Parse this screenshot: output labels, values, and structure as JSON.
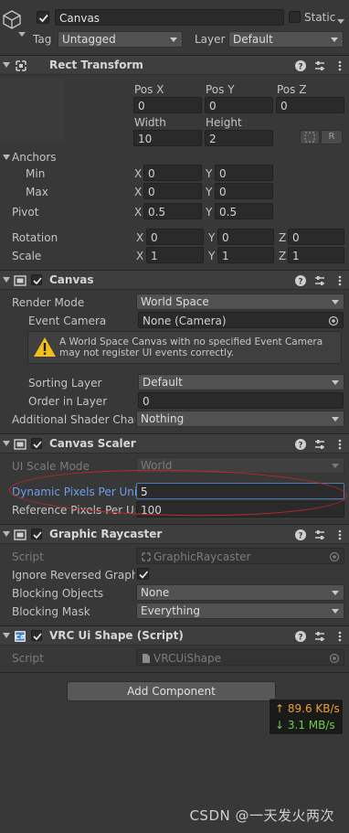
{
  "gameobject": {
    "name": "Canvas",
    "static_label": "Static",
    "tag_label": "Tag",
    "tag_value": "Untagged",
    "layer_label": "Layer",
    "layer_value": "Default"
  },
  "rect_transform": {
    "title": "Rect Transform",
    "pos_x_label": "Pos X",
    "pos_y_label": "Pos Y",
    "pos_z_label": "Pos Z",
    "pos_x": "0",
    "pos_y": "0",
    "pos_z": "0",
    "width_label": "Width",
    "height_label": "Height",
    "width": "10",
    "height": "2",
    "r_button": "R",
    "anchors_label": "Anchors",
    "min_label": "Min",
    "max_label": "Max",
    "anchor_min_x": "0",
    "anchor_min_y": "0",
    "anchor_max_x": "0",
    "anchor_max_y": "0",
    "pivot_label": "Pivot",
    "pivot_x": "0.5",
    "pivot_y": "0.5",
    "rotation_label": "Rotation",
    "rot_x": "0",
    "rot_y": "0",
    "rot_z": "0",
    "scale_label": "Scale",
    "scale_x": "1",
    "scale_y": "1",
    "scale_z": "1",
    "x": "X",
    "y": "Y",
    "z": "Z"
  },
  "canvas": {
    "title": "Canvas",
    "render_mode_label": "Render Mode",
    "render_mode": "World Space",
    "event_camera_label": "Event Camera",
    "event_camera": "None (Camera)",
    "warning": "A World Space Canvas with no specified Event Camera may not register UI events correctly.",
    "sorting_layer_label": "Sorting Layer",
    "sorting_layer": "Default",
    "order_label": "Order in Layer",
    "order": "0",
    "shader_label": "Additional Shader Chani",
    "shader": "Nothing"
  },
  "canvas_scaler": {
    "title": "Canvas Scaler",
    "ui_scale_label": "UI Scale Mode",
    "ui_scale": "World",
    "dpu_label": "Dynamic Pixels Per Unit",
    "dpu": "5",
    "rppu_label": "Reference Pixels Per Un",
    "rppu": "100"
  },
  "graphic_raycaster": {
    "title": "Graphic Raycaster",
    "script_label": "Script",
    "script": "GraphicRaycaster",
    "ignore_label": "Ignore Reversed Graphic",
    "blocking_objects_label": "Blocking Objects",
    "blocking_objects": "None",
    "blocking_mask_label": "Blocking Mask",
    "blocking_mask": "Everything"
  },
  "vrc": {
    "title": "VRC Ui Shape (Script)",
    "script_label": "Script",
    "script": "VRCUiShape"
  },
  "add_component": "Add Component",
  "net": {
    "up": "↑ 89.6 KB/s",
    "down": "↓ 3.1 MB/s",
    "up_color": "#f0a030",
    "down_color": "#6cd04a"
  },
  "watermark": "CSDN @一天发火两次",
  "colors": {
    "bg": "#383838",
    "header": "#3e3e3e",
    "field": "#2a2a2a",
    "highlight_label": "#6a9ee8",
    "ellipse": "#c0282a"
  }
}
